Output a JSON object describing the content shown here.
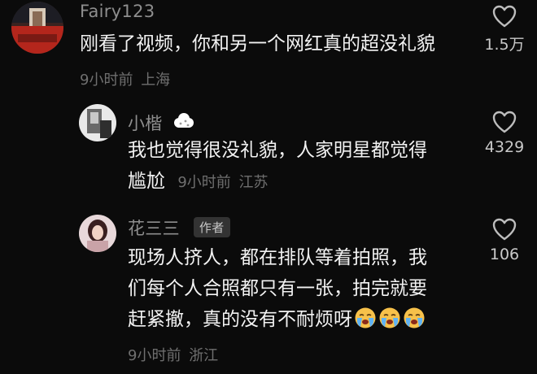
{
  "comments": [
    {
      "username": "Fairy123",
      "text_lines": [
        "刚看了视频，你和另一个网红真的超没礼貌"
      ],
      "time": "9小时前",
      "location": "上海",
      "likes": "1.5万"
    },
    {
      "username": "小楷",
      "text_lines": [
        "我也觉得很没礼貌，人家明星都觉得"
      ],
      "text_last": "尴尬",
      "time": "9小时前",
      "location": "江苏",
      "likes": "4329"
    },
    {
      "username": "花三三",
      "author_badge": "作者",
      "text_lines": [
        "现场人挤人，都在排队等着拍照，我",
        "们每个人合照都只有一张，拍完就要"
      ],
      "text_last": "赶紧撤，真的没有不耐烦呀",
      "emoji": [
        "crying-face-icon",
        "crying-face-icon",
        "crying-face-icon"
      ],
      "time": "9小时前",
      "location": "浙江",
      "likes": "106"
    }
  ],
  "colors": {
    "background": "#0b0b0b",
    "username": "#8e8e8e",
    "text": "#f2f2f2",
    "meta": "#6f6f6f"
  }
}
